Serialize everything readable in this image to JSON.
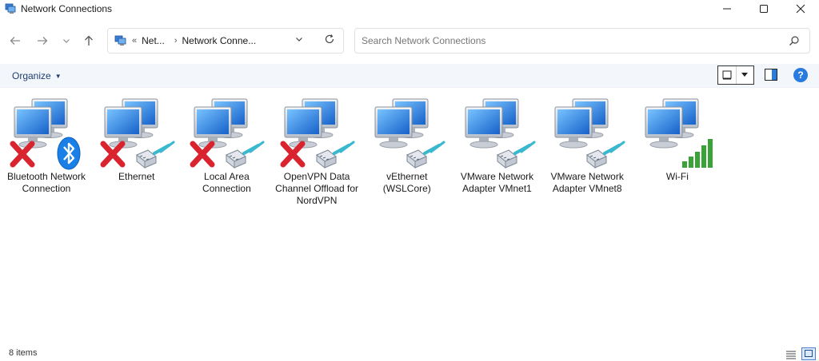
{
  "window": {
    "title": "Network Connections",
    "controls": {
      "minimize": "minimize",
      "maximize": "maximize",
      "close": "close"
    }
  },
  "nav": {
    "breadcrumb_overflow": "«",
    "breadcrumb": [
      "Net...",
      "Network Conne..."
    ],
    "search_placeholder": "Search Network Connections"
  },
  "commandbar": {
    "organize_label": "Organize"
  },
  "items": [
    {
      "label": "Bluetooth Network Connection",
      "status": "disconnected",
      "adapter": "bluetooth"
    },
    {
      "label": "Ethernet",
      "status": "disconnected",
      "adapter": "cable"
    },
    {
      "label": "Local Area Connection",
      "status": "disconnected",
      "adapter": "cable"
    },
    {
      "label": "OpenVPN Data Channel Offload for NordVPN",
      "status": "disconnected",
      "adapter": "cable"
    },
    {
      "label": "vEthernet (WSLCore)",
      "status": "connected",
      "adapter": "cable"
    },
    {
      "label": "VMware Network Adapter VMnet1",
      "status": "connected",
      "adapter": "cable"
    },
    {
      "label": "VMware Network Adapter VMnet8",
      "status": "connected",
      "adapter": "cable"
    },
    {
      "label": "Wi-Fi",
      "status": "connected",
      "adapter": "wifi"
    }
  ],
  "statusbar": {
    "count": "8 items"
  },
  "colors": {
    "accent": "#2a7bde",
    "command_bar_bg": "#f3f6fa",
    "disconnected_x": "#d9232e",
    "wifi_bars": "#3aa337"
  }
}
